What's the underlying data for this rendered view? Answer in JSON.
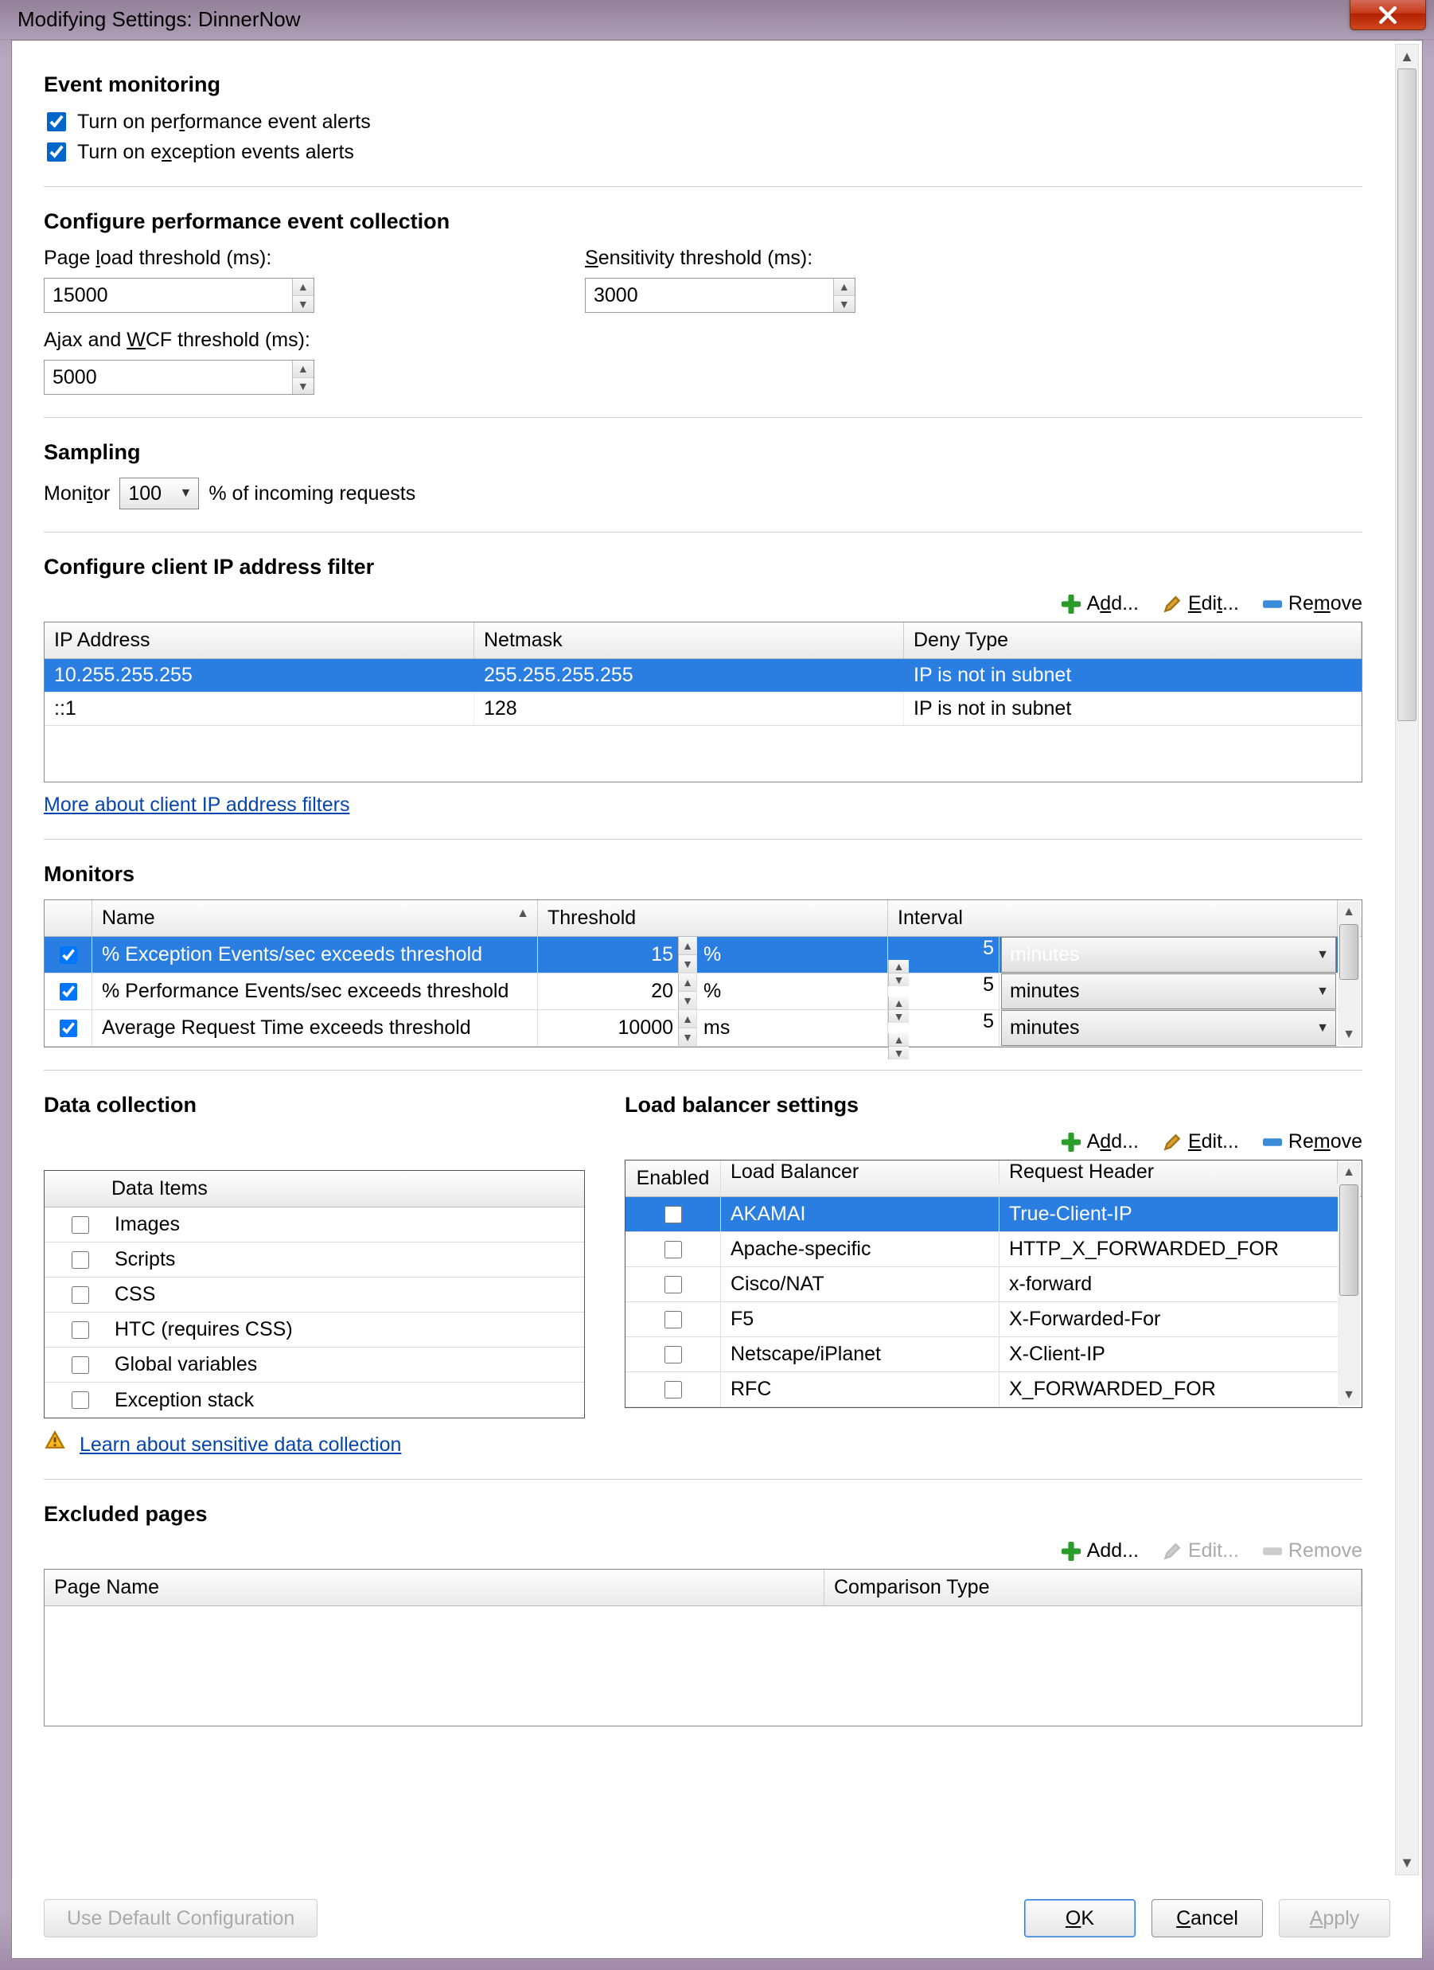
{
  "title": "Modifying Settings: DinnerNow",
  "eventMonitoring": {
    "heading": "Event monitoring",
    "perfAlerts": {
      "label_pre": "Turn on per",
      "label_accel": "f",
      "label_post": "ormance event alerts",
      "checked": true
    },
    "excAlerts": {
      "label_pre": "Turn on e",
      "label_accel": "x",
      "label_post": "ception events alerts",
      "checked": true
    }
  },
  "perfCollection": {
    "heading": "Configure performance event collection",
    "pageLoad": {
      "label_pre": "Page ",
      "label_accel": "l",
      "label_post": "oad threshold (ms):",
      "value": "15000"
    },
    "sensitivity": {
      "label_accel": "S",
      "label_post": "ensitivity threshold (ms):",
      "value": "3000"
    },
    "ajax": {
      "label_pre": "Ajax and ",
      "label_accel": "W",
      "label_post": "CF threshold (ms):",
      "value": "5000"
    }
  },
  "sampling": {
    "heading": "Sampling",
    "label_pre": "Moni",
    "label_accel": "t",
    "label_post": "or",
    "value": "100",
    "suffix": "% of incoming requests"
  },
  "ipFilter": {
    "heading": "Configure client IP address filter",
    "toolbar": {
      "add": "Add...",
      "edit": "Edit...",
      "remove": "Remove"
    },
    "columns": {
      "ip": "IP Address",
      "mask": "Netmask",
      "deny": "Deny Type"
    },
    "rows": [
      {
        "ip": "10.255.255.255",
        "mask": "255.255.255.255",
        "deny": "IP is not in subnet",
        "selected": true
      },
      {
        "ip": "::1",
        "mask": "128",
        "deny": "IP is not in subnet",
        "selected": false
      }
    ],
    "link": "More about client IP address filters"
  },
  "monitors": {
    "heading": "Monitors",
    "columns": {
      "name": "Name",
      "threshold": "Threshold",
      "interval": "Interval"
    },
    "rows": [
      {
        "checked": true,
        "name": "% Exception Events/sec exceeds threshold",
        "threshold": "15",
        "unit": "%",
        "interval": "5",
        "intervalUnit": "minutes",
        "selected": true
      },
      {
        "checked": true,
        "name": "% Performance Events/sec exceeds threshold",
        "threshold": "20",
        "unit": "%",
        "interval": "5",
        "intervalUnit": "minutes",
        "selected": false
      },
      {
        "checked": true,
        "name": "Average Request Time exceeds threshold",
        "threshold": "10000",
        "unit": "ms",
        "interval": "5",
        "intervalUnit": "minutes",
        "selected": false
      }
    ]
  },
  "dataCollection": {
    "heading": "Data collection",
    "header": "Data Items",
    "items": [
      {
        "label": "Images",
        "checked": false
      },
      {
        "label": "Scripts",
        "checked": false
      },
      {
        "label": "CSS",
        "checked": false
      },
      {
        "label": "HTC (requires CSS)",
        "checked": false
      },
      {
        "label": "Global variables",
        "checked": false
      },
      {
        "label": "Exception stack",
        "checked": false
      }
    ],
    "link": "Learn about sensitive data collection"
  },
  "loadBalancer": {
    "heading": "Load balancer settings",
    "toolbar": {
      "add_accel": "d",
      "add_pre": "A",
      "add_post": "d...",
      "edit_accel": "E",
      "edit_post": "dit...",
      "remove_accel": "m",
      "remove_pre": "Re",
      "remove_post": "ove"
    },
    "columns": {
      "enabled": "Enabled",
      "lb": "Load Balancer",
      "rh": "Request Header"
    },
    "rows": [
      {
        "enabled": false,
        "lb": "AKAMAI",
        "rh": "True-Client-IP",
        "selected": true
      },
      {
        "enabled": false,
        "lb": "Apache-specific",
        "rh": "HTTP_X_FORWARDED_FOR",
        "selected": false
      },
      {
        "enabled": false,
        "lb": "Cisco/NAT",
        "rh": "x-forward",
        "selected": false
      },
      {
        "enabled": false,
        "lb": "F5",
        "rh": "X-Forwarded-For",
        "selected": false
      },
      {
        "enabled": false,
        "lb": "Netscape/iPlanet",
        "rh": "X-Client-IP",
        "selected": false
      },
      {
        "enabled": false,
        "lb": "RFC",
        "rh": "X_FORWARDED_FOR",
        "selected": false
      }
    ]
  },
  "excludedPages": {
    "heading": "Excluded pages",
    "toolbar": {
      "add": "Add...",
      "edit": "Edit...",
      "remove": "Remove"
    },
    "columns": {
      "page": "Page Name",
      "comp": "Comparison Type"
    }
  },
  "footer": {
    "defaultCfg": "Use Default Configuration",
    "ok_accel": "O",
    "ok_post": "K",
    "cancel_accel": "C",
    "cancel_post": "ancel",
    "apply_accel": "A",
    "apply_post": "pply"
  }
}
